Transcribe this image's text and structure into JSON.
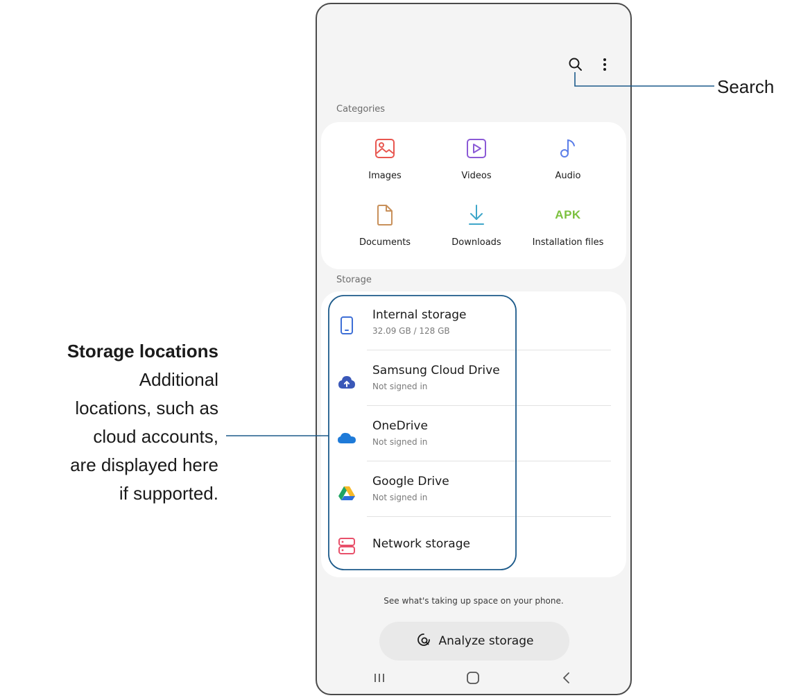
{
  "annotations": {
    "search_label": "Search",
    "storage_title": "Storage locations",
    "storage_desc_lines": [
      "Additional",
      "locations, such as",
      "cloud accounts,",
      "are displayed here",
      "if supported."
    ]
  },
  "toolbar": {
    "search_icon": "search-icon",
    "more_icon": "more-vertical-icon"
  },
  "categories": {
    "label": "Categories",
    "items": [
      {
        "label": "Images",
        "icon": "image-icon",
        "color": "#e8564f"
      },
      {
        "label": "Videos",
        "icon": "video-icon",
        "color": "#8b5ad6"
      },
      {
        "label": "Audio",
        "icon": "music-note-icon",
        "color": "#5b7ee8"
      },
      {
        "label": "Documents",
        "icon": "document-icon",
        "color": "#c8905a"
      },
      {
        "label": "Downloads",
        "icon": "download-icon",
        "color": "#3ea6c9"
      },
      {
        "label": "Installation files",
        "icon": "APK",
        "color": "#7cc13f"
      }
    ]
  },
  "storage": {
    "label": "Storage",
    "items": [
      {
        "title": "Internal storage",
        "subtitle": "32.09 GB / 128 GB",
        "icon": "phone-icon",
        "color": "#3e6fd6"
      },
      {
        "title": "Samsung Cloud Drive",
        "subtitle": "Not signed in",
        "icon": "samsung-cloud-icon",
        "color": "#3a58b8"
      },
      {
        "title": "OneDrive",
        "subtitle": "Not signed in",
        "icon": "onedrive-icon",
        "color": "#1e7ad8"
      },
      {
        "title": "Google Drive",
        "subtitle": "Not signed in",
        "icon": "google-drive-icon",
        "color": "#1fa463"
      },
      {
        "title": "Network storage",
        "subtitle": "",
        "icon": "network-storage-icon",
        "color": "#e8506a"
      }
    ]
  },
  "footer": {
    "hint": "See what's taking up space on your phone.",
    "analyze_label": "Analyze storage",
    "analyze_icon": "analyze-storage-icon"
  },
  "navbar": {
    "recents_icon": "recents-icon",
    "home_icon": "home-icon",
    "back_icon": "back-icon"
  },
  "colors": {
    "annotation_line": "#1c5a8a",
    "card_bg": "#ffffff",
    "screen_bg": "#f4f4f4"
  }
}
